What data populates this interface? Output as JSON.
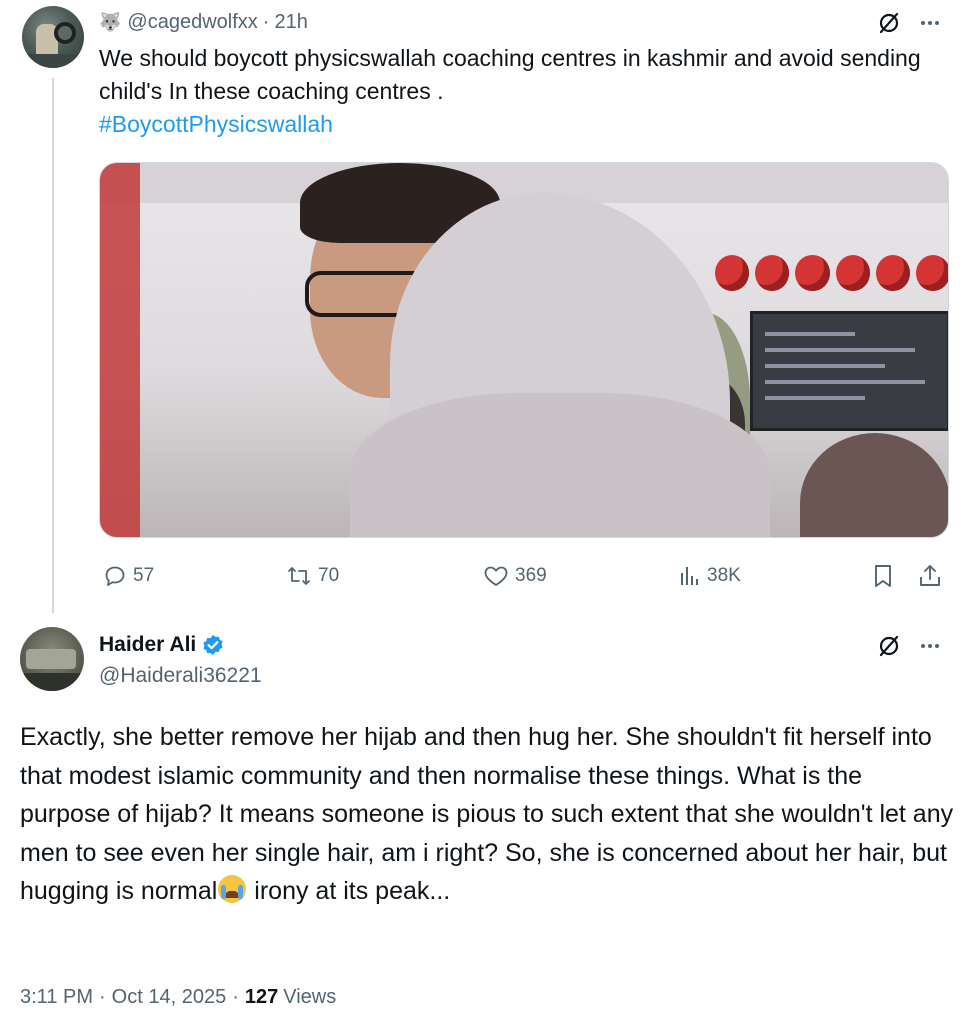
{
  "parent": {
    "handle": "@cagedwolfxx",
    "separator": "·",
    "time": "21h",
    "text": "We should boycott physicswallah coaching centres in kashmir and avoid sending child's In these coaching centres .",
    "hashtag": "#BoycottPhysicswallah",
    "replies": "57",
    "reposts": "70",
    "likes": "369",
    "views": "38K",
    "handle_icon": "wolf-emoji"
  },
  "reply": {
    "name": "Haider Ali",
    "handle": "@Haiderali36221",
    "verified_badge": "blue-check",
    "text_before_emoji": "Exactly, she better remove her hijab and then hug her. She shouldn't fit herself into that modest islamic community and then normalise these things. What is the purpose of hijab? It means someone is pious to such extent that she wouldn't let any men to see even her single hair, am i right? So, she is concerned about her hair, but hugging is normal",
    "emoji": "loudly-crying-face",
    "text_after_emoji": " irony at its peak...",
    "time": "3:11 PM",
    "date": "Oct 14, 2025",
    "sep1": "·",
    "sep2": "·",
    "views_count": "127",
    "views_label": "Views"
  },
  "colors": {
    "link": "#1d9bf0",
    "text": "#0f1419",
    "secondary": "#536471",
    "border": "#cfd9de"
  }
}
